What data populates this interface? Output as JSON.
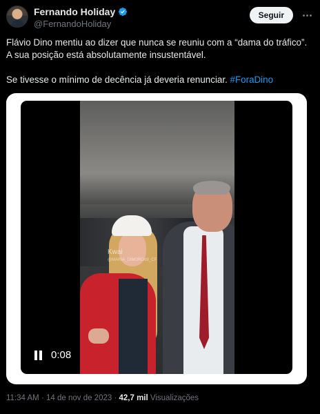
{
  "author": {
    "display_name": "Fernando Holiday",
    "handle": "@FernandoHoliday",
    "verified_icon": "verified-badge-icon",
    "accent_color": "#1d9bf0"
  },
  "header": {
    "follow_label": "Seguir",
    "more_icon": "more-options-icon"
  },
  "tweet": {
    "line1": "Flávio Dino mentiu ao dizer que nunca se reuniu com a “dama do tráfico”.",
    "line2": "A sua posição está absolutamente insustentável.",
    "line3_text": "Se tivesse o mínimo de decência já deveria renunciar. ",
    "hashtag": "#ForaDino"
  },
  "video": {
    "watermark": "Kwai",
    "watermark_sub": "@MARIA_DIMORO69_CF",
    "time": "0:08",
    "pause_icon": "pause-icon"
  },
  "meta": {
    "time": "11:34 AM",
    "separator": " · ",
    "date": "14 de nov de 2023",
    "separator2": " · ",
    "views_count": "42,7 mil",
    "views_label": " Visualizações"
  }
}
